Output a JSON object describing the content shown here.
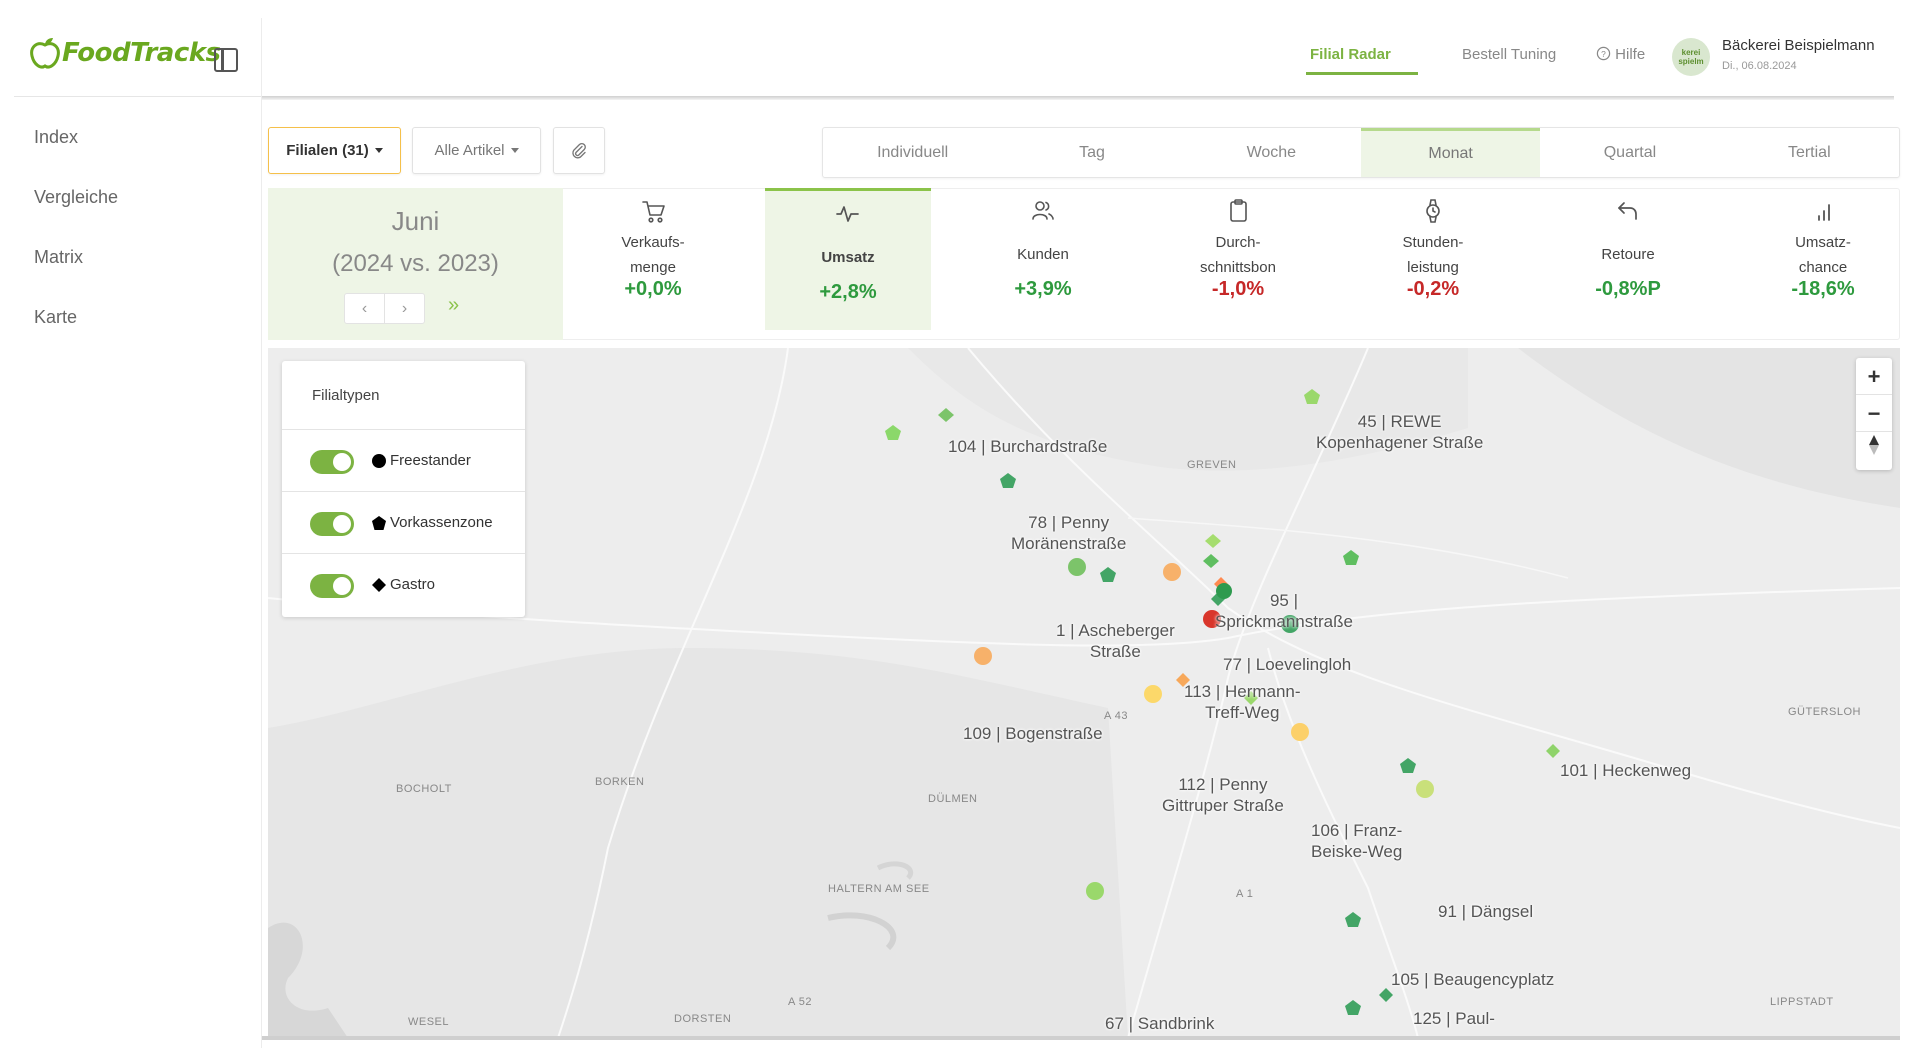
{
  "app": {
    "logo_text": "FoodTracks"
  },
  "sidebar": {
    "items": [
      "Index",
      "Vergleiche",
      "Matrix",
      "Karte"
    ]
  },
  "header": {
    "tabs": [
      "Filial Radar",
      "Bestell Tuning"
    ],
    "help": "Hilfe",
    "avatar_text": "kerei spielm",
    "user_name": "Bäckerei Beispielmann",
    "user_date": "Di., 06.08.2024"
  },
  "filters": {
    "filialen": "Filialen (31)",
    "artikel": "Alle Artikel"
  },
  "periods": [
    "Individuell",
    "Tag",
    "Woche",
    "Monat",
    "Quartal",
    "Tertial"
  ],
  "month": {
    "name": "Juni",
    "compare": "(2024 vs. 2023)",
    "prev": "‹",
    "next": "›",
    "skip": "»"
  },
  "kpis": [
    {
      "l1": "Verkaufs-",
      "l2": "menge",
      "value": "+0,0%",
      "icon": "cart-icon"
    },
    {
      "l1": "Umsatz",
      "l2": "",
      "value": "+2,8%",
      "icon": "pulse-icon"
    },
    {
      "l1": "Kunden",
      "l2": "",
      "value": "+3,9%",
      "icon": "users-icon"
    },
    {
      "l1": "Durch-",
      "l2": "schnittsbon",
      "value": "-1,0%",
      "icon": "clipboard-icon"
    },
    {
      "l1": "Stunden-",
      "l2": "leistung",
      "value": "-0,2%",
      "icon": "watch-icon"
    },
    {
      "l1": "Retoure",
      "l2": "",
      "value": "-0,8%P",
      "icon": "return-icon"
    },
    {
      "l1": "Umsatz-",
      "l2": "chance",
      "value": "-18,6%",
      "icon": "bar-chart-icon"
    }
  ],
  "legend": {
    "title": "Filialtypen",
    "types": [
      "Freestander",
      "Vorkassenzone",
      "Gastro"
    ]
  },
  "map": {
    "labels": [
      {
        "l1": "104 | Burchardstraße",
        "l2": ""
      },
      {
        "l1": "45 | REWE",
        "l2": "Kopenhagener Straße"
      },
      {
        "l1": "78 | Penny",
        "l2": "Moränenstraße"
      },
      {
        "l1": "95 |",
        "l2": "Sprickmannstraße"
      },
      {
        "l1": "1 | Ascheberger",
        "l2": "Straße"
      },
      {
        "l1": "77 | Loevelingloh",
        "l2": ""
      },
      {
        "l1": "113 | Hermann-",
        "l2": "Treff-Weg"
      },
      {
        "l1": "109 | Bogenstraße",
        "l2": ""
      },
      {
        "l1": "101 | Heckenweg",
        "l2": ""
      },
      {
        "l1": "112 | Penny",
        "l2": "Gittruper Straße"
      },
      {
        "l1": "106 | Franz-",
        "l2": "Beiske-Weg"
      },
      {
        "l1": "91 | Dängsel",
        "l2": ""
      },
      {
        "l1": "105 | Beaugencyplatz",
        "l2": ""
      },
      {
        "l1": "67 | Sandbrink",
        "l2": ""
      },
      {
        "l1": "125 | Paul-",
        "l2": ""
      }
    ],
    "cities": [
      "GREVEN",
      "GÜTERSLOH",
      "BOCHOLT",
      "BORKEN",
      "DÜLMEN",
      "HALTERN AM SEE",
      "WESEL",
      "DORSTEN",
      "LIPPSTADT",
      "A 43",
      "A 1",
      "A 52"
    ]
  }
}
